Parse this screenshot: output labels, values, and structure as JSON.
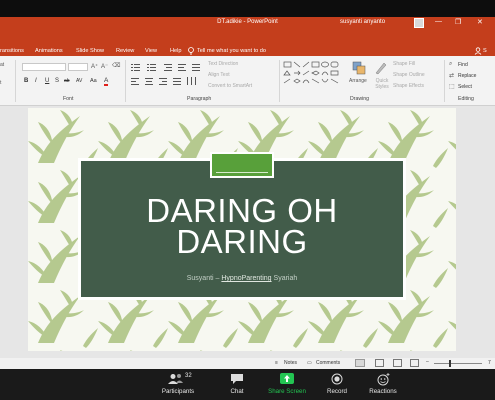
{
  "window": {
    "title": "DT.adikie - PowerPoint",
    "user": "susyanti anyanto",
    "controls": [
      "—",
      "❐",
      "✕"
    ]
  },
  "tabs": [
    "ransitions",
    "Animations",
    "Slide Show",
    "Review",
    "View",
    "Help"
  ],
  "tell_me": "Tell me what you want to do",
  "sign_in": "S",
  "ribbon": {
    "font_group": "Font",
    "paragraph_group": "Paragraph",
    "drawing_group": "Drawing",
    "editing_group": "Editing",
    "format_buttons": [
      "B",
      "I",
      "U",
      "S",
      "ab",
      "AV",
      "Aa",
      "A"
    ],
    "text_direction": "Text Direction",
    "align_text": "Align Text",
    "convert_smartart": "Convert to SmartArt",
    "arrange": "Arrange",
    "quick_styles": "Quick Styles",
    "shape_fill": "Shape Fill",
    "shape_outline": "Shape Outline",
    "shape_effects": "Shape Effects",
    "find": "Find",
    "replace": "Replace",
    "select": "Select",
    "left_partials": [
      "at",
      "",
      "t"
    ]
  },
  "slide": {
    "title_line1": "DARING OH",
    "title_line2": "DARING",
    "subtitle_prefix": "Susyanti – ",
    "subtitle_link": "HypnoParenting",
    "subtitle_suffix": " Syariah"
  },
  "statusbar": {
    "notes": "Notes",
    "comments": "Comments",
    "zoom": "7"
  },
  "zoom": {
    "participants_count": "32",
    "participants": "Participants",
    "chat": "Chat",
    "share_screen": "Share Screen",
    "record": "Record",
    "reactions": "Reactions"
  },
  "colors": {
    "ppt_red": "#c43e1c",
    "slide_dark_green": "#425c4a",
    "accent_green": "#58a03a",
    "leaf_green": "#b5c98f",
    "share_green": "#23c552"
  }
}
